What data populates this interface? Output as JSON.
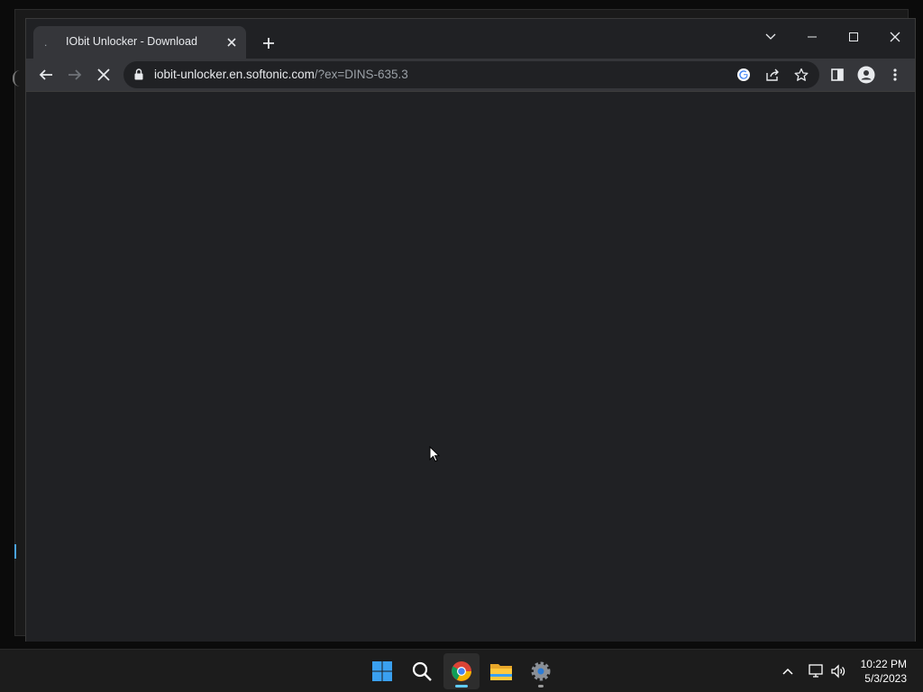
{
  "browser": {
    "tab": {
      "title": "IObit Unlocker - Download",
      "favicon": "."
    },
    "url": {
      "host": "iobit-unlocker.en.softonic.com",
      "path": "/?ex=DINS-635.3"
    }
  },
  "taskbar": {
    "apps": [
      "windows-start",
      "search",
      "chrome",
      "file-explorer",
      "settings"
    ],
    "clock": {
      "time": "10:22 PM",
      "date": "5/3/2023"
    }
  },
  "colors": {
    "accent": "#60cdff",
    "window_bg": "#202124",
    "toolbar_bg": "#35363a"
  }
}
